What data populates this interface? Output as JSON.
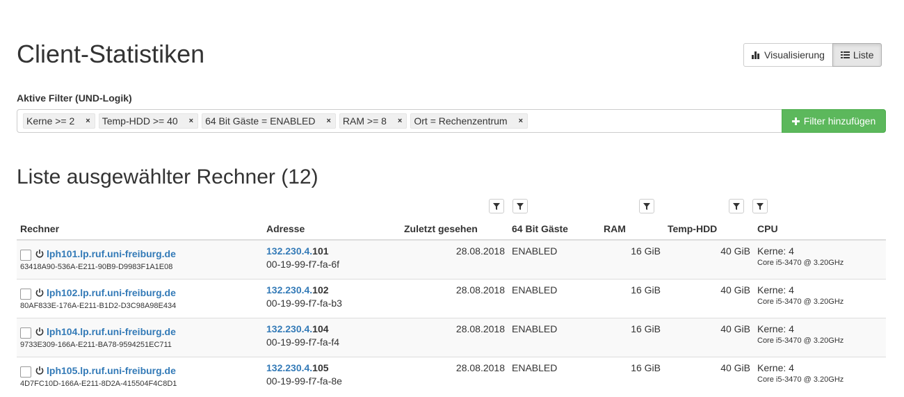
{
  "header": {
    "title": "Client-Statistiken",
    "view_visual_label": "Visualisierung",
    "view_list_label": "Liste"
  },
  "filters": {
    "label": "Aktive Filter (UND-Logik)",
    "tags": [
      {
        "text": "Kerne >= 2"
      },
      {
        "text": "Temp-HDD >= 40"
      },
      {
        "text": "64 Bit Gäste = ENABLED"
      },
      {
        "text": "RAM >= 8"
      },
      {
        "text": "Ort = Rechenzentrum"
      }
    ],
    "remove_glyph": "×",
    "add_label": "Filter hinzufügen"
  },
  "list": {
    "title": "Liste ausgewählter Rechner (12)",
    "columns": {
      "rechner": "Rechner",
      "adresse": "Adresse",
      "zuletzt": "Zuletzt gesehen",
      "gaeste": "64 Bit Gäste",
      "ram": "RAM",
      "temphdd": "Temp-HDD",
      "cpu": "CPU"
    },
    "rows": [
      {
        "host": "lph101.lp.ruf.uni-freiburg.de",
        "uuid": "63418A90-536A-E211-90B9-D9983F1A1E08",
        "ip_prefix": "132.230.4.",
        "ip_suffix": "101",
        "mac": "00-19-99-f7-fa-6f",
        "last_seen": "28.08.2018",
        "guests64": "ENABLED",
        "ram": "16 GiB",
        "temphdd": "40 GiB",
        "cores": "Kerne: 4",
        "cpu_model": "Core i5-3470 @ 3.20GHz"
      },
      {
        "host": "lph102.lp.ruf.uni-freiburg.de",
        "uuid": "80AF833E-176A-E211-B1D2-D3C98A98E434",
        "ip_prefix": "132.230.4.",
        "ip_suffix": "102",
        "mac": "00-19-99-f7-fa-b3",
        "last_seen": "28.08.2018",
        "guests64": "ENABLED",
        "ram": "16 GiB",
        "temphdd": "40 GiB",
        "cores": "Kerne: 4",
        "cpu_model": "Core i5-3470 @ 3.20GHz"
      },
      {
        "host": "lph104.lp.ruf.uni-freiburg.de",
        "uuid": "9733E309-166A-E211-BA78-9594251EC711",
        "ip_prefix": "132.230.4.",
        "ip_suffix": "104",
        "mac": "00-19-99-f7-fa-f4",
        "last_seen": "28.08.2018",
        "guests64": "ENABLED",
        "ram": "16 GiB",
        "temphdd": "40 GiB",
        "cores": "Kerne: 4",
        "cpu_model": "Core i5-3470 @ 3.20GHz"
      },
      {
        "host": "lph105.lp.ruf.uni-freiburg.de",
        "uuid": "4D7FC10D-166A-E211-8D2A-415504F4C8D1",
        "ip_prefix": "132.230.4.",
        "ip_suffix": "105",
        "mac": "00-19-99-f7-fa-8e",
        "last_seen": "28.08.2018",
        "guests64": "ENABLED",
        "ram": "16 GiB",
        "temphdd": "40 GiB",
        "cores": "Kerne: 4",
        "cpu_model": "Core i5-3470 @ 3.20GHz"
      }
    ]
  },
  "colors": {
    "link": "#337ab7",
    "success": "#5cb85c",
    "border": "#dddddd"
  },
  "icons": {
    "visual": "bar-chart-icon",
    "list": "list-icon",
    "add": "plus-icon",
    "column_filter": "filter-icon",
    "host_status": "power-icon"
  }
}
